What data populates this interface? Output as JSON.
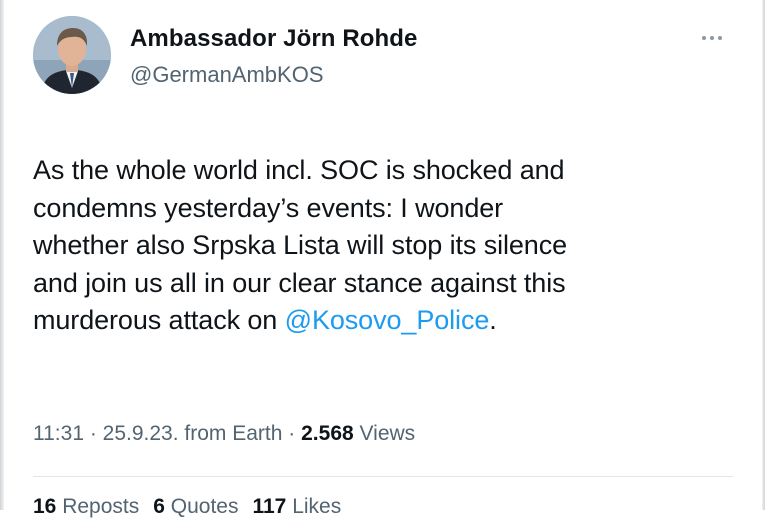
{
  "author": {
    "name": "Ambassador Jörn Rohde",
    "handle": "@GermanAmbKOS"
  },
  "menu": {
    "icon": "more-horizontal-icon"
  },
  "tweet": {
    "line1": "As the whole world incl. SOC is shocked and",
    "line2": "condemns yesterday’s events: I wonder",
    "line3": "whether also Srpska Lista will stop its silence",
    "line4": "and join us all in our clear stance against this",
    "line5_prefix": "murderous attack on ",
    "mention": "@Kosovo_Police",
    "line5_suffix": "."
  },
  "meta": {
    "time": "11:31",
    "sep1": " · ",
    "date": "25.9.23.",
    "source": " from Earth",
    "sep2": " · ",
    "views_count": "2.568",
    "views_label": " Views"
  },
  "stats": {
    "reposts_count": "16",
    "reposts_label": " Reposts",
    "quotes_count": "6",
    "quotes_label": " Quotes",
    "likes_count": "117",
    "likes_label": " Likes"
  },
  "colors": {
    "text": "#0f1419",
    "secondary": "#536471",
    "link": "#1d9bf0"
  }
}
